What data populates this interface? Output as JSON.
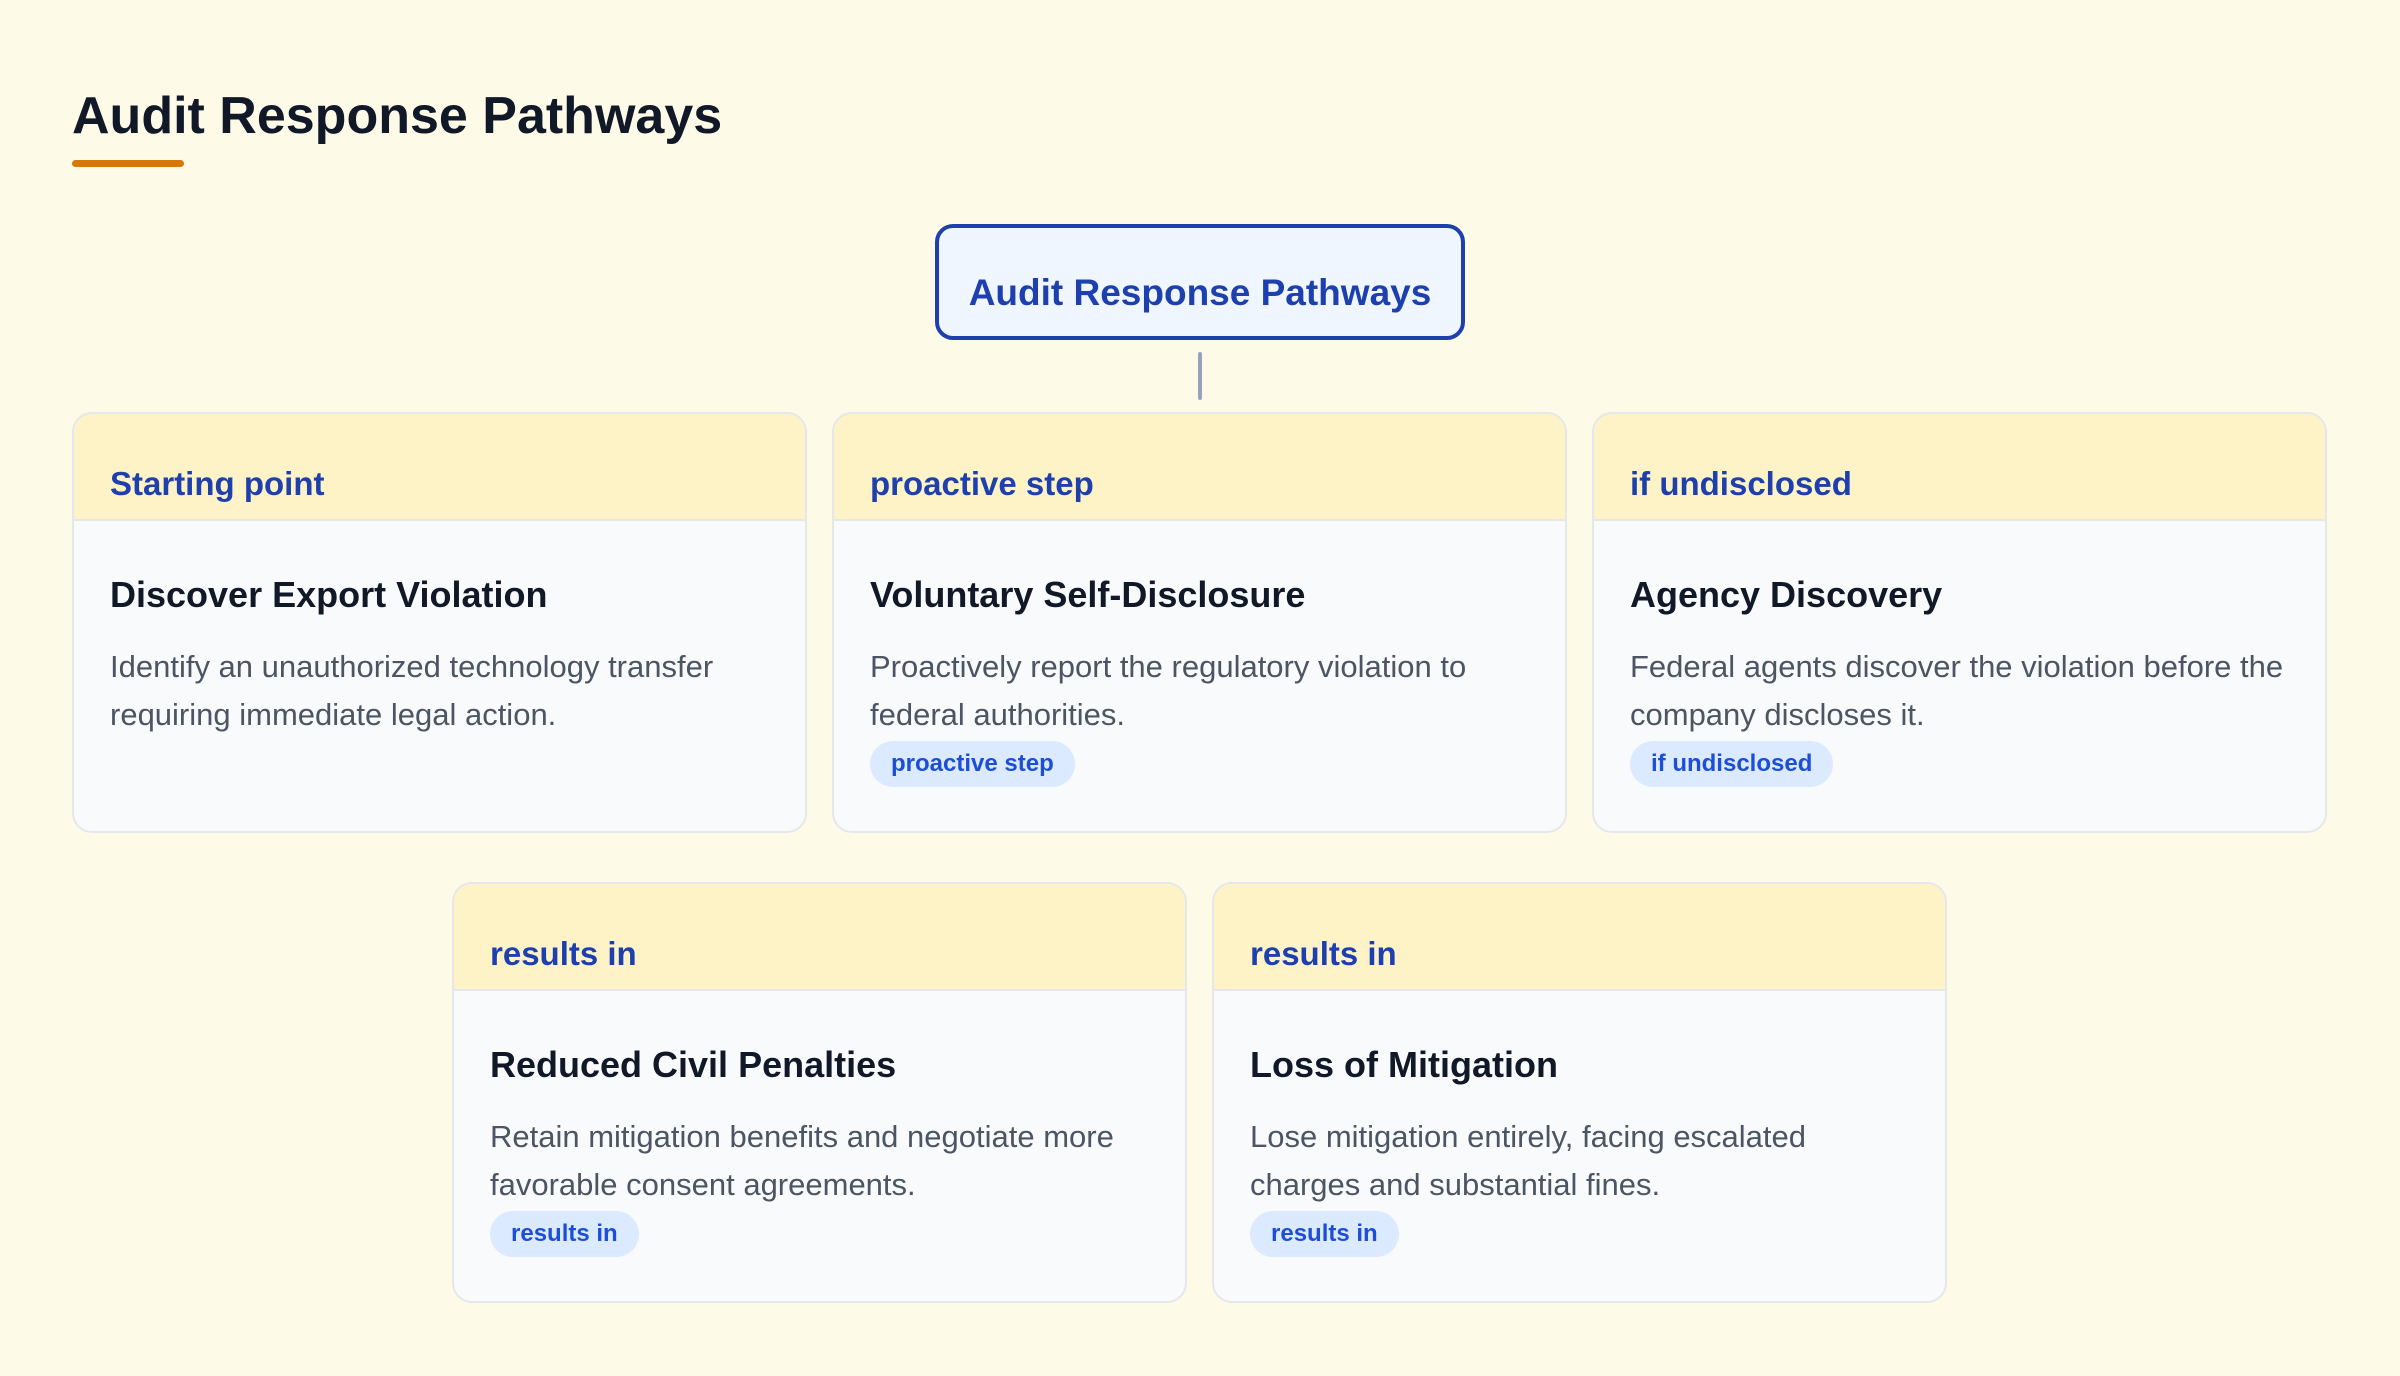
{
  "page": {
    "title": "Audit Response Pathways"
  },
  "diagram": {
    "root": {
      "label": "Audit Response Pathways"
    },
    "nodes": [
      {
        "header": "Starting point",
        "title": "Discover Export Violation",
        "description": "Identify an unauthorized technology transfer requiring immediate legal action.",
        "tag": ""
      },
      {
        "header": "proactive step",
        "title": "Voluntary Self-Disclosure",
        "description": "Proactively report the regulatory violation to federal authorities.",
        "tag": "proactive step"
      },
      {
        "header": "if undisclosed",
        "title": "Agency Discovery",
        "description": "Federal agents discover the violation before the company discloses it.",
        "tag": "if undisclosed"
      },
      {
        "header": "results in",
        "title": "Reduced Civil Penalties",
        "description": "Retain mitigation benefits and negotiate more favorable consent agreements.",
        "tag": "results in"
      },
      {
        "header": "results in",
        "title": "Loss of Mitigation",
        "description": "Lose mitigation entirely, facing escalated charges and substantial fines.",
        "tag": "results in"
      }
    ]
  },
  "colors": {
    "background": "#fefae8",
    "accent": "#d97706",
    "primary": "#1e40af",
    "card_header": "#fef3c7",
    "tag_background": "#dbeafe"
  }
}
